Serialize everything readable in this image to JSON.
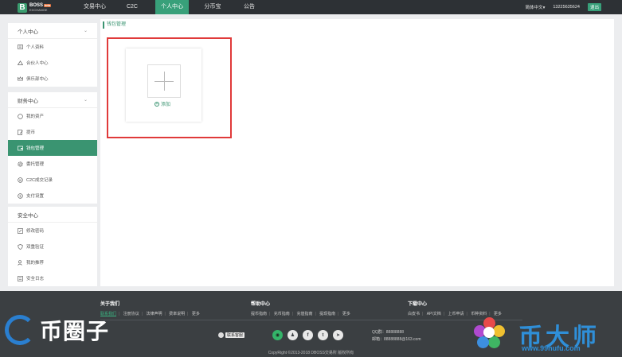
{
  "brand": {
    "mark": "B",
    "name": "BOSS",
    "sub": "EXCHANGE",
    "badge": "beta"
  },
  "nav": {
    "items": [
      {
        "label": "交易中心"
      },
      {
        "label": "C2C"
      },
      {
        "label": "个人中心",
        "active": true
      },
      {
        "label": "分币宝"
      },
      {
        "label": "公告"
      }
    ],
    "language": "简体中文",
    "phone": "13225635624",
    "logout": "退出"
  },
  "sidebar": {
    "personal": {
      "title": "个人中心",
      "items": [
        {
          "label": "个人资料",
          "icon": "id-card-icon"
        },
        {
          "label": "合伙人中心",
          "icon": "partner-icon"
        },
        {
          "label": "俱乐部中心",
          "icon": "crown-icon"
        }
      ]
    },
    "finance": {
      "title": "财务中心",
      "items": [
        {
          "label": "我的资产",
          "icon": "coin-icon"
        },
        {
          "label": "提币",
          "icon": "edit-icon"
        },
        {
          "label": "钱包管理",
          "icon": "wallet-icon",
          "active": true
        },
        {
          "label": "委托管理",
          "icon": "gear-icon"
        },
        {
          "label": "C2C成交记录",
          "icon": "swap-icon"
        },
        {
          "label": "支付设置",
          "icon": "currency-icon"
        }
      ]
    },
    "security": {
      "title": "安全中心",
      "items": [
        {
          "label": "修改密码",
          "icon": "pencil-icon"
        },
        {
          "label": "双重验证",
          "icon": "shield-icon"
        },
        {
          "label": "我的推荐",
          "icon": "users-icon"
        },
        {
          "label": "安全日志",
          "icon": "log-icon"
        }
      ]
    }
  },
  "main": {
    "breadcrumb": "钱包管理",
    "add_label": "添加"
  },
  "footer": {
    "about": {
      "title": "关于我们",
      "links": [
        "联系我们",
        "注册协议",
        "法律声明",
        "费率说明",
        "更多"
      ]
    },
    "help": {
      "title": "帮助中心",
      "links": [
        "提币指南",
        "充币指南",
        "充值指南",
        "提现指南",
        "更多"
      ]
    },
    "download": {
      "title": "下载中心",
      "links": [
        "白皮书",
        "API文档",
        "上币申请",
        "币种资料",
        "更多"
      ]
    },
    "contact_label": "联系客服",
    "qq": "QQ群：88888888",
    "email": "邮箱：88888888@163.com",
    "copyright": "CopyRight ©2013-2018 DBOSS交易所 版权所有"
  },
  "watermarks": {
    "left": "币圈子",
    "right": "币大师",
    "right_url": "www.99hufu.com"
  },
  "colors": {
    "accent": "#38a07a",
    "topbar": "#2d3135",
    "footer": "#3b3f42",
    "highlight": "#e03a3a"
  }
}
